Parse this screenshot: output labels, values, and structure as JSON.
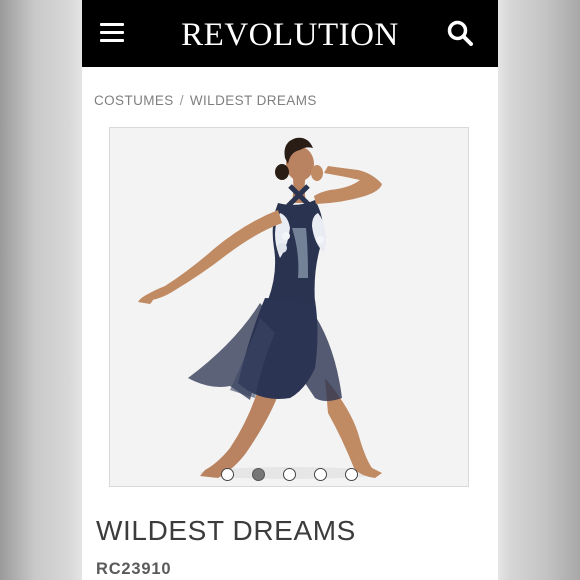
{
  "header": {
    "logo": "REVOLUTION",
    "menu_icon": "hamburger-menu-icon",
    "search_icon": "search-icon",
    "background": "#000000"
  },
  "breadcrumb": {
    "items": [
      "COSTUMES",
      "WILDEST DREAMS"
    ],
    "separator": "/"
  },
  "gallery": {
    "image_description_icon": "product-photo",
    "slide_count": 5,
    "active_slide": 2,
    "dress_color": "#2a3350"
  },
  "product": {
    "title": "WILDEST DREAMS",
    "sku": "RC23910"
  }
}
